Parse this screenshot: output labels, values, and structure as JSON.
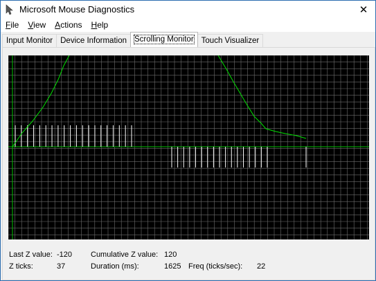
{
  "window": {
    "title": "Microsoft Mouse Diagnostics",
    "close_glyph": "✕"
  },
  "menu": [
    {
      "accel": "F",
      "rest": "ile"
    },
    {
      "accel": "V",
      "rest": "iew"
    },
    {
      "accel": "A",
      "rest": "ctions"
    },
    {
      "accel": "H",
      "rest": "elp"
    }
  ],
  "tabs": [
    {
      "label": "Input Monitor",
      "active": false
    },
    {
      "label": "Device Information",
      "active": false
    },
    {
      "label": "Scrolling Monitor",
      "active": true
    },
    {
      "label": "Touch Visualizer",
      "active": false
    }
  ],
  "stats": {
    "last_z_label": "Last Z value:",
    "last_z_value": "-120",
    "cumulative_z_label": "Cumulative Z value:",
    "cumulative_z_value": "120",
    "z_ticks_label": "Z ticks:",
    "z_ticks_value": "37",
    "duration_label": "Duration (ms):",
    "duration_value": "1625",
    "freq_label": "Freq (ticks/sec):",
    "freq_value": "22"
  },
  "plot": {
    "background": "#000000",
    "grid_color": "#6f6f6f",
    "axis_color": "#00c000",
    "line_color": "#00e000",
    "tick_color": "#ffffff",
    "ticks_up": 20,
    "ticks_down": 17,
    "trace": [
      [
        0,
        0
      ],
      [
        1,
        20
      ],
      [
        2,
        45
      ],
      [
        3,
        75
      ],
      [
        4,
        102
      ],
      [
        5,
        130
      ],
      [
        6,
        160
      ]
    ],
    "trace2": [
      [
        0,
        160
      ],
      [
        1,
        150
      ],
      [
        2,
        120
      ],
      [
        3,
        90
      ],
      [
        4,
        60
      ],
      [
        5,
        35
      ],
      [
        6,
        20
      ],
      [
        7,
        15
      ],
      [
        8,
        12
      ],
      [
        9,
        10
      ],
      [
        10,
        5
      ]
    ]
  },
  "colors": {
    "window_border": "#2b6cb0",
    "titlebar": "#ffffff",
    "chrome": "#f0f0f0"
  }
}
